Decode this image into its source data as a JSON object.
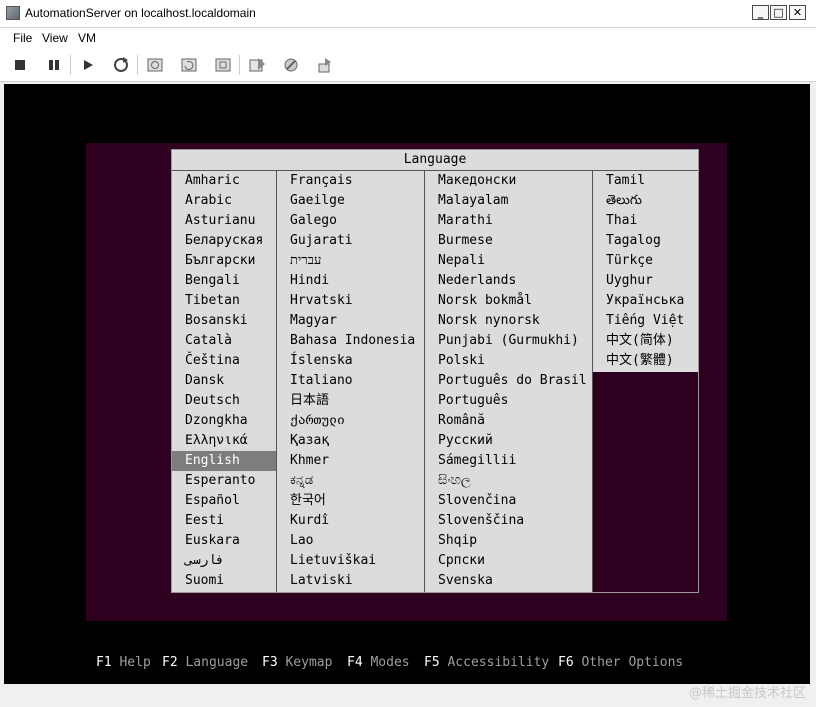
{
  "window": {
    "title": "AutomationServer on localhost.localdomain",
    "controls": {
      "minimize": "_",
      "maximize": "□",
      "close": "✕"
    }
  },
  "menubar": {
    "items": [
      "File",
      "View",
      "VM"
    ]
  },
  "toolbar": {
    "buttons": [
      {
        "name": "stop-icon"
      },
      {
        "name": "pause-icon"
      },
      {
        "name": "play-icon"
      },
      {
        "name": "reset-icon"
      },
      {
        "name": "snapshot-take-icon"
      },
      {
        "name": "snapshot-revert-icon"
      },
      {
        "name": "snapshot-manager-icon"
      },
      {
        "name": "send-ctrl-alt-del-icon"
      },
      {
        "name": "settings-icon"
      },
      {
        "name": "install-tools-icon"
      }
    ]
  },
  "boot_menu": {
    "title": "Language",
    "selected": "English",
    "columns": [
      [
        "Amharic",
        "Arabic",
        "Asturianu",
        "Беларуская",
        "Български",
        "Bengali",
        "Tibetan",
        "Bosanski",
        "Català",
        "Čeština",
        "Dansk",
        "Deutsch",
        "Dzongkha",
        "Ελληνικά",
        "English",
        "Esperanto",
        "Español",
        "Eesti",
        "Euskara",
        "فارسی",
        "Suomi"
      ],
      [
        "Français",
        "Gaeilge",
        "Galego",
        "Gujarati",
        "עברית",
        "Hindi",
        "Hrvatski",
        "Magyar",
        "Bahasa Indonesia",
        "Íslenska",
        "Italiano",
        "日本語",
        "ქართული",
        "Қазақ",
        "Khmer",
        "ಕನ್ನಡ",
        "한국어",
        "Kurdî",
        "Lao",
        "Lietuviškai",
        "Latviski"
      ],
      [
        "Македонски",
        "Malayalam",
        "Marathi",
        "Burmese",
        "Nepali",
        "Nederlands",
        "Norsk bokmål",
        "Norsk nynorsk",
        "Punjabi (Gurmukhi)",
        "Polski",
        "Português do Brasil",
        "Português",
        "Română",
        "Русский",
        "Sámegillii",
        "සිංහල",
        "Slovenčina",
        "Slovenščina",
        "Shqip",
        "Српски",
        "Svenska"
      ],
      [
        "Tamil",
        "తెలుగు",
        "Thai",
        "Tagalog",
        "Türkçe",
        "Uyghur",
        "Українська",
        "Tiếng Việt",
        "中文(简体)",
        "中文(繁體)"
      ]
    ],
    "function_keys": [
      {
        "key": "F1",
        "label": "Help"
      },
      {
        "key": "F2",
        "label": "Language"
      },
      {
        "key": "F3",
        "label": "Keymap"
      },
      {
        "key": "F4",
        "label": "Modes"
      },
      {
        "key": "F5",
        "label": "Accessibility"
      },
      {
        "key": "F6",
        "label": "Other Options"
      }
    ]
  },
  "watermark": "@稀土掘金技术社区"
}
